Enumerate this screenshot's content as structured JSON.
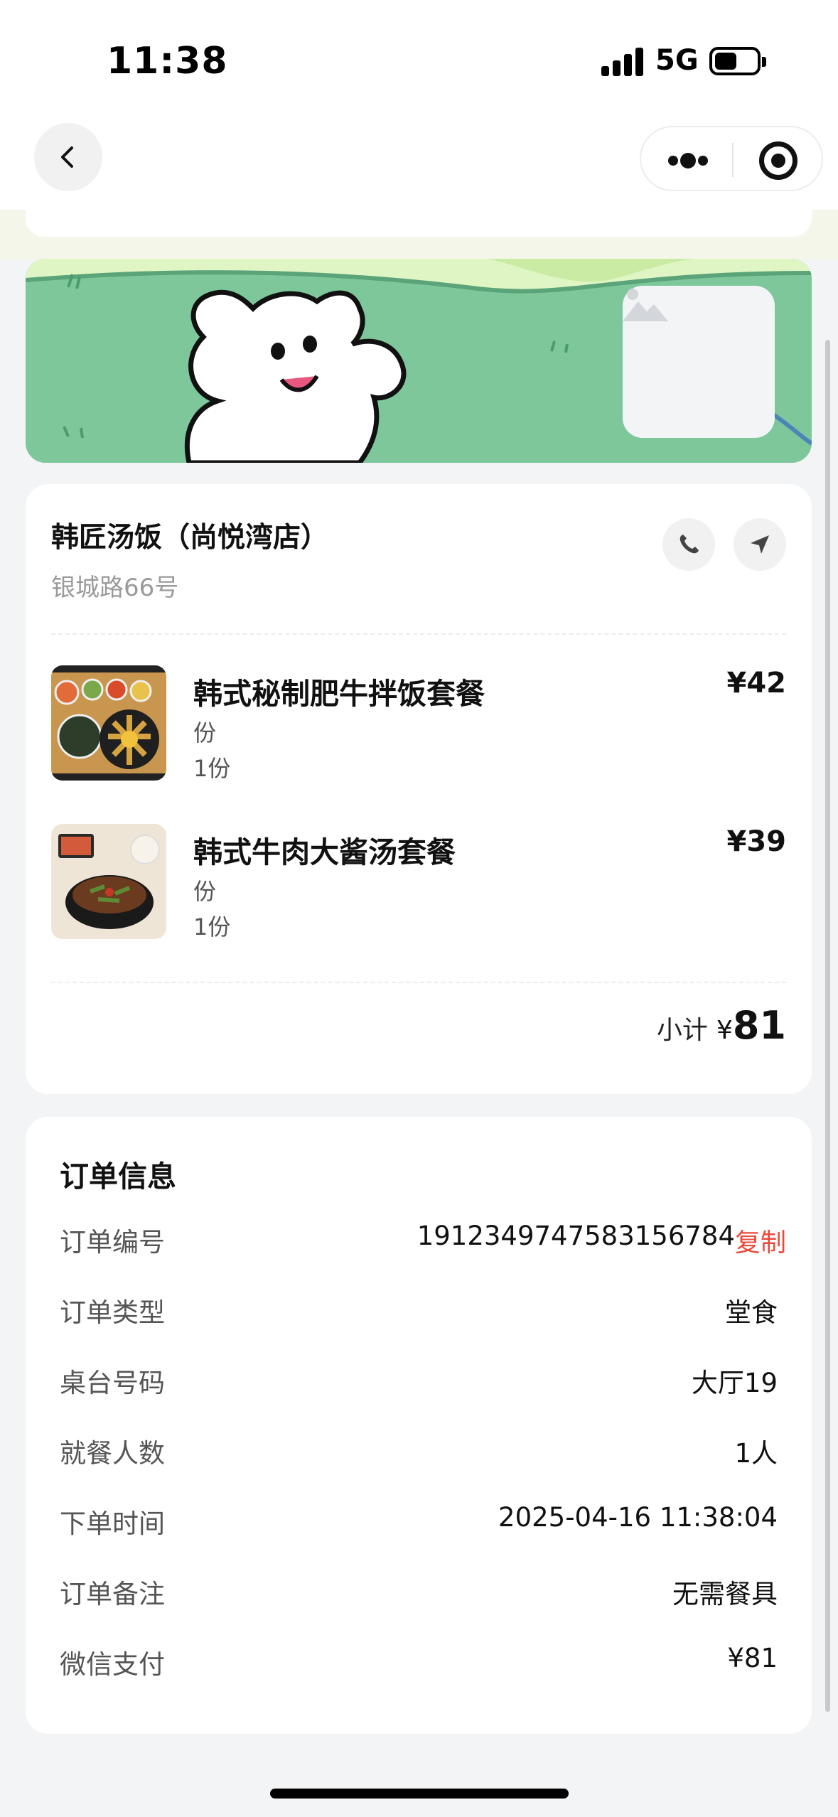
{
  "status_bar": {
    "time": "11:38",
    "network": "5G",
    "battery_icon": "battery-icon",
    "signal_icon": "signal-icon"
  },
  "nav": {
    "back_icon": "chevron-left-icon",
    "more_icon": "more-dots-icon",
    "close_icon": "target-circle-icon"
  },
  "banner": {
    "placeholder_icon": "image-placeholder-icon"
  },
  "store": {
    "name": "韩匠汤饭（尚悦湾店）",
    "address": "银城路66号",
    "phone_icon": "phone-icon",
    "navigate_icon": "navigate-arrow-icon"
  },
  "items": [
    {
      "name": "韩式秘制肥牛拌饭套餐",
      "unit": "份",
      "qty": "1份",
      "price": "¥42"
    },
    {
      "name": "韩式牛肉大酱汤套餐",
      "unit": "份",
      "qty": "1份",
      "price": "¥39"
    }
  ],
  "subtotal": {
    "label": "小计",
    "currency": "¥",
    "amount": "81"
  },
  "order_info": {
    "title": "订单信息",
    "copy_label": "复制",
    "rows": [
      {
        "key": "订单编号",
        "value": "1912349747583156784"
      },
      {
        "key": "订单类型",
        "value": "堂食"
      },
      {
        "key": "桌台号码",
        "value": "大厅19"
      },
      {
        "key": "就餐人数",
        "value": "1人"
      },
      {
        "key": "下单时间",
        "value": "2025-04-16 11:38:04"
      },
      {
        "key": "订单备注",
        "value": "无需餐具"
      },
      {
        "key": "微信支付",
        "value": "¥81"
      }
    ]
  },
  "colors": {
    "accent_red": "#e94a3b",
    "banner_green": "#7ec79b",
    "background": "#f3f4f6"
  }
}
